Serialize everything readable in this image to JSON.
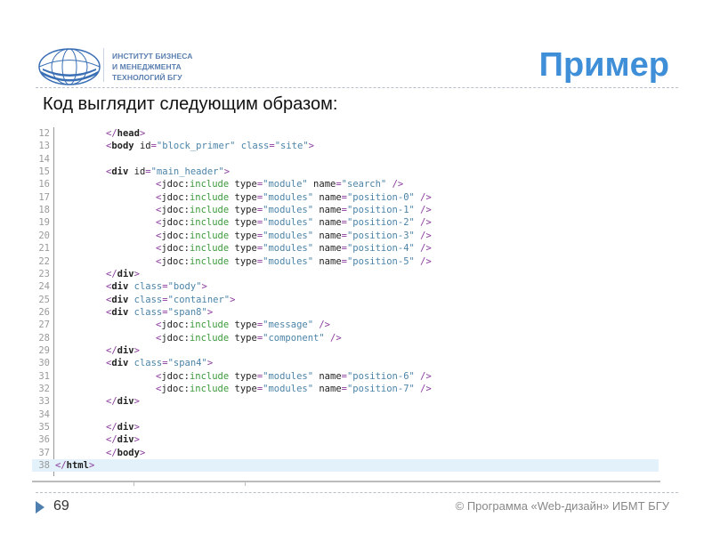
{
  "header": {
    "logo_lines": [
      "ИНСТИТУТ БИЗНЕСА",
      "И МЕНЕДЖМЕНТА",
      "ТЕХНОЛОГИЙ БГУ"
    ],
    "title": "Пример",
    "subtitle": "Код выглядит следующим образом:"
  },
  "colors": {
    "title": "#3f8fd8",
    "logo": "#3a6fb5",
    "highlight": "#e3f1fa"
  },
  "code": {
    "highlighted_line": "38",
    "lines": [
      {
        "n": "12",
        "i": 2,
        "t": [
          [
            "p",
            "</"
          ],
          [
            "e",
            "head"
          ],
          [
            "p",
            ">"
          ]
        ]
      },
      {
        "n": "13",
        "i": 2,
        "t": [
          [
            "p",
            "<"
          ],
          [
            "e",
            "body "
          ],
          [
            "a",
            "id"
          ],
          [
            "p",
            "="
          ],
          [
            "v",
            "\"block_primer\" "
          ],
          [
            "v",
            "class"
          ],
          [
            "p",
            "="
          ],
          [
            "v",
            "\"site\""
          ],
          [
            "p",
            ">"
          ]
        ]
      },
      {
        "n": "14",
        "i": 2,
        "t": []
      },
      {
        "n": "15",
        "i": 2,
        "t": [
          [
            "p",
            "<"
          ],
          [
            "e",
            "div "
          ],
          [
            "a",
            "id"
          ],
          [
            "p",
            "="
          ],
          [
            "v",
            "\"main_header\""
          ],
          [
            "p",
            ">"
          ]
        ]
      },
      {
        "n": "16",
        "i": 3,
        "t": [
          [
            "p",
            "<"
          ],
          [
            "k",
            "jdoc:"
          ],
          [
            "g",
            "include "
          ],
          [
            "a",
            "type"
          ],
          [
            "p",
            "="
          ],
          [
            "v",
            "\"module\" "
          ],
          [
            "a",
            "name"
          ],
          [
            "p",
            "="
          ],
          [
            "v",
            "\"search\" "
          ],
          [
            "p",
            "/>"
          ]
        ]
      },
      {
        "n": "17",
        "i": 3,
        "t": [
          [
            "p",
            "<"
          ],
          [
            "k",
            "jdoc:"
          ],
          [
            "g",
            "include "
          ],
          [
            "a",
            "type"
          ],
          [
            "p",
            "="
          ],
          [
            "v",
            "\"modules\" "
          ],
          [
            "a",
            "name"
          ],
          [
            "p",
            "="
          ],
          [
            "v",
            "\"position-0\" "
          ],
          [
            "p",
            "/>"
          ]
        ]
      },
      {
        "n": "18",
        "i": 3,
        "t": [
          [
            "p",
            "<"
          ],
          [
            "k",
            "jdoc:"
          ],
          [
            "g",
            "include "
          ],
          [
            "a",
            "type"
          ],
          [
            "p",
            "="
          ],
          [
            "v",
            "\"modules\" "
          ],
          [
            "a",
            "name"
          ],
          [
            "p",
            "="
          ],
          [
            "v",
            "\"position-1\" "
          ],
          [
            "p",
            "/>"
          ]
        ]
      },
      {
        "n": "19",
        "i": 3,
        "t": [
          [
            "p",
            "<"
          ],
          [
            "k",
            "jdoc:"
          ],
          [
            "g",
            "include "
          ],
          [
            "a",
            "type"
          ],
          [
            "p",
            "="
          ],
          [
            "v",
            "\"modules\" "
          ],
          [
            "a",
            "name"
          ],
          [
            "p",
            "="
          ],
          [
            "v",
            "\"position-2\" "
          ],
          [
            "p",
            "/>"
          ]
        ]
      },
      {
        "n": "20",
        "i": 3,
        "t": [
          [
            "p",
            "<"
          ],
          [
            "k",
            "jdoc:"
          ],
          [
            "g",
            "include "
          ],
          [
            "a",
            "type"
          ],
          [
            "p",
            "="
          ],
          [
            "v",
            "\"modules\" "
          ],
          [
            "a",
            "name"
          ],
          [
            "p",
            "="
          ],
          [
            "v",
            "\"position-3\" "
          ],
          [
            "p",
            "/>"
          ]
        ]
      },
      {
        "n": "21",
        "i": 3,
        "t": [
          [
            "p",
            "<"
          ],
          [
            "k",
            "jdoc:"
          ],
          [
            "g",
            "include "
          ],
          [
            "a",
            "type"
          ],
          [
            "p",
            "="
          ],
          [
            "v",
            "\"modules\" "
          ],
          [
            "a",
            "name"
          ],
          [
            "p",
            "="
          ],
          [
            "v",
            "\"position-4\" "
          ],
          [
            "p",
            "/>"
          ]
        ]
      },
      {
        "n": "22",
        "i": 3,
        "t": [
          [
            "p",
            "<"
          ],
          [
            "k",
            "jdoc:"
          ],
          [
            "g",
            "include "
          ],
          [
            "a",
            "type"
          ],
          [
            "p",
            "="
          ],
          [
            "v",
            "\"modules\" "
          ],
          [
            "a",
            "name"
          ],
          [
            "p",
            "="
          ],
          [
            "v",
            "\"position-5\" "
          ],
          [
            "p",
            "/>"
          ]
        ]
      },
      {
        "n": "23",
        "i": 2,
        "t": [
          [
            "p",
            "</"
          ],
          [
            "e",
            "div"
          ],
          [
            "p",
            ">"
          ]
        ]
      },
      {
        "n": "24",
        "i": 2,
        "t": [
          [
            "p",
            "<"
          ],
          [
            "e",
            "div "
          ],
          [
            "v",
            "class"
          ],
          [
            "p",
            "="
          ],
          [
            "v",
            "\"body\""
          ],
          [
            "p",
            ">"
          ]
        ]
      },
      {
        "n": "25",
        "i": 2,
        "t": [
          [
            "p",
            "<"
          ],
          [
            "e",
            "div "
          ],
          [
            "v",
            "class"
          ],
          [
            "p",
            "="
          ],
          [
            "v",
            "\"container\""
          ],
          [
            "p",
            ">"
          ]
        ]
      },
      {
        "n": "26",
        "i": 2,
        "t": [
          [
            "p",
            "<"
          ],
          [
            "e",
            "div "
          ],
          [
            "v",
            "class"
          ],
          [
            "p",
            "="
          ],
          [
            "v",
            "\"span8\""
          ],
          [
            "p",
            ">"
          ]
        ]
      },
      {
        "n": "27",
        "i": 3,
        "t": [
          [
            "p",
            "<"
          ],
          [
            "k",
            "jdoc:"
          ],
          [
            "g",
            "include "
          ],
          [
            "a",
            "type"
          ],
          [
            "p",
            "="
          ],
          [
            "v",
            "\"message\" "
          ],
          [
            "p",
            "/>"
          ]
        ]
      },
      {
        "n": "28",
        "i": 3,
        "t": [
          [
            "p",
            "<"
          ],
          [
            "k",
            "jdoc:"
          ],
          [
            "g",
            "include "
          ],
          [
            "a",
            "type"
          ],
          [
            "p",
            "="
          ],
          [
            "v",
            "\"component\" "
          ],
          [
            "p",
            "/>"
          ]
        ]
      },
      {
        "n": "29",
        "i": 2,
        "t": [
          [
            "p",
            "</"
          ],
          [
            "e",
            "div"
          ],
          [
            "p",
            ">"
          ]
        ]
      },
      {
        "n": "30",
        "i": 2,
        "t": [
          [
            "p",
            "<"
          ],
          [
            "e",
            "div "
          ],
          [
            "v",
            "class"
          ],
          [
            "p",
            "="
          ],
          [
            "v",
            "\"span4\""
          ],
          [
            "p",
            ">"
          ]
        ]
      },
      {
        "n": "31",
        "i": 3,
        "t": [
          [
            "p",
            "<"
          ],
          [
            "k",
            "jdoc:"
          ],
          [
            "g",
            "include "
          ],
          [
            "a",
            "type"
          ],
          [
            "p",
            "="
          ],
          [
            "v",
            "\"modules\" "
          ],
          [
            "a",
            "name"
          ],
          [
            "p",
            "="
          ],
          [
            "v",
            "\"position-6\" "
          ],
          [
            "p",
            "/>"
          ]
        ]
      },
      {
        "n": "32",
        "i": 3,
        "t": [
          [
            "p",
            "<"
          ],
          [
            "k",
            "jdoc:"
          ],
          [
            "g",
            "include "
          ],
          [
            "a",
            "type"
          ],
          [
            "p",
            "="
          ],
          [
            "v",
            "\"modules\" "
          ],
          [
            "a",
            "name"
          ],
          [
            "p",
            "="
          ],
          [
            "v",
            "\"position-7\" "
          ],
          [
            "p",
            "/>"
          ]
        ]
      },
      {
        "n": "33",
        "i": 2,
        "t": [
          [
            "p",
            "</"
          ],
          [
            "e",
            "div"
          ],
          [
            "p",
            ">"
          ]
        ]
      },
      {
        "n": "34",
        "i": 2,
        "t": []
      },
      {
        "n": "35",
        "i": 2,
        "t": [
          [
            "p",
            "</"
          ],
          [
            "e",
            "div"
          ],
          [
            "p",
            ">"
          ]
        ]
      },
      {
        "n": "36",
        "i": 2,
        "t": [
          [
            "p",
            "</"
          ],
          [
            "e",
            "div"
          ],
          [
            "p",
            ">"
          ]
        ]
      },
      {
        "n": "37",
        "i": 2,
        "t": [
          [
            "p",
            "</"
          ],
          [
            "e",
            "body"
          ],
          [
            "p",
            ">"
          ]
        ]
      },
      {
        "n": "38",
        "i": 0,
        "t": [
          [
            "p",
            "</"
          ],
          [
            "e",
            "html"
          ],
          [
            "p",
            ">"
          ]
        ]
      }
    ]
  },
  "footer": {
    "page_number": "69",
    "copyright": "© Программа «Web-дизайн» ИБМТ БГУ"
  }
}
